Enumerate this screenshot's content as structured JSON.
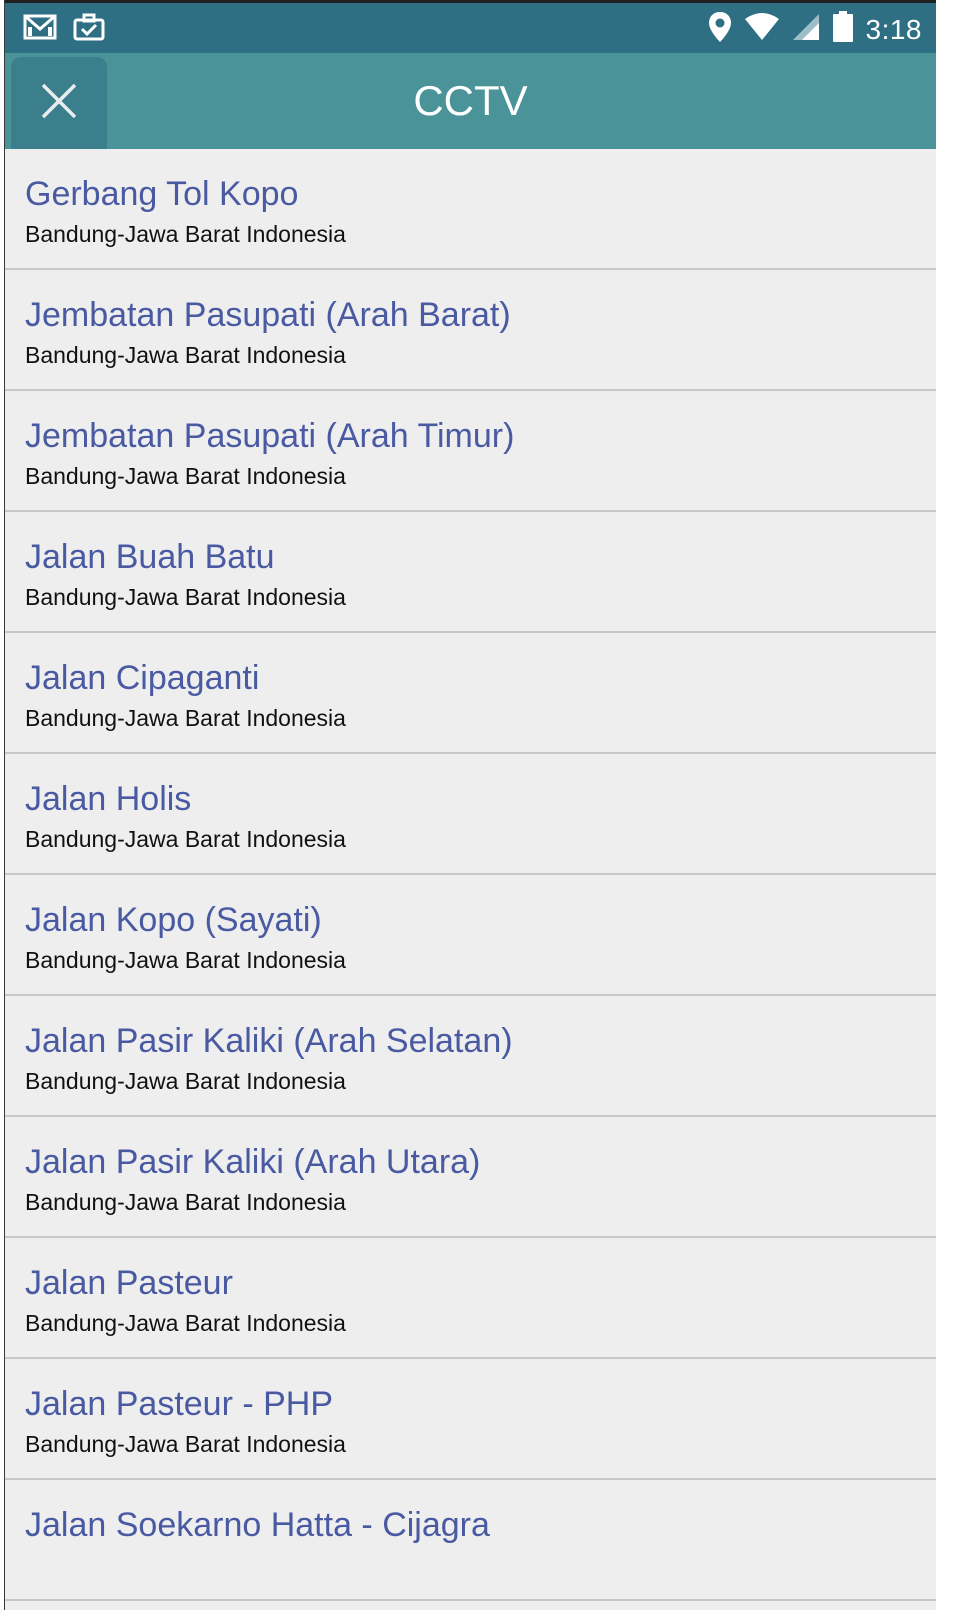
{
  "status_bar": {
    "time": "3:18",
    "icons": [
      "gmail-icon",
      "briefcase-icon",
      "location-icon",
      "wifi-icon",
      "signal-icon",
      "battery-icon"
    ]
  },
  "app_bar": {
    "title": "CCTV",
    "close_icon": "close-icon"
  },
  "colors": {
    "status_bar": "#2e6f84",
    "app_bar": "#4a9399",
    "close_button": "#3b7e8c",
    "item_title": "#4a5aa2",
    "background": "#eeeeee"
  },
  "list": {
    "items": [
      {
        "title": "Gerbang Tol Kopo",
        "subtitle": "Bandung-Jawa Barat Indonesia"
      },
      {
        "title": "Jembatan Pasupati (Arah Barat)",
        "subtitle": "Bandung-Jawa Barat Indonesia"
      },
      {
        "title": "Jembatan Pasupati (Arah Timur)",
        "subtitle": "Bandung-Jawa Barat Indonesia"
      },
      {
        "title": "Jalan Buah Batu",
        "subtitle": "Bandung-Jawa Barat Indonesia"
      },
      {
        "title": "Jalan Cipaganti",
        "subtitle": "Bandung-Jawa Barat Indonesia"
      },
      {
        "title": "Jalan Holis",
        "subtitle": "Bandung-Jawa Barat Indonesia"
      },
      {
        "title": "Jalan Kopo (Sayati)",
        "subtitle": "Bandung-Jawa Barat Indonesia"
      },
      {
        "title": "Jalan Pasir Kaliki (Arah Selatan)",
        "subtitle": "Bandung-Jawa Barat Indonesia"
      },
      {
        "title": "Jalan Pasir Kaliki (Arah Utara)",
        "subtitle": "Bandung-Jawa Barat Indonesia"
      },
      {
        "title": "Jalan Pasteur",
        "subtitle": "Bandung-Jawa Barat Indonesia"
      },
      {
        "title": "Jalan Pasteur - PHP",
        "subtitle": "Bandung-Jawa Barat Indonesia"
      },
      {
        "title": "Jalan Soekarno Hatta - Cijagra",
        "subtitle": ""
      }
    ]
  }
}
